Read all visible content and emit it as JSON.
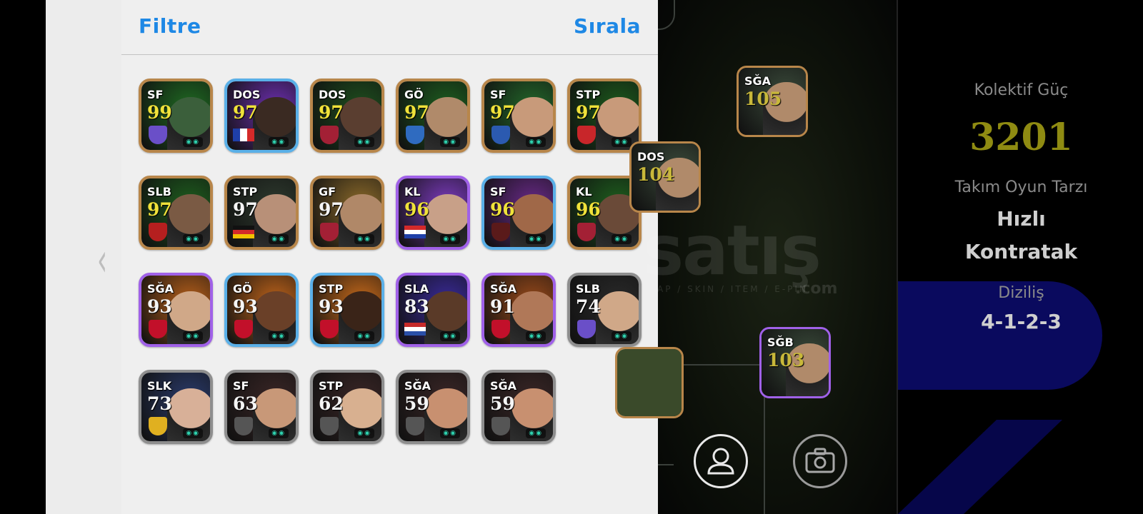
{
  "header": {
    "filter_label": "Filtre",
    "sort_label": "Sırala"
  },
  "cards": [
    {
      "pos": "SF",
      "rating": "99",
      "frame": "gold",
      "bg": "#1f6b22",
      "rating_color": "yellow",
      "badge": "#6a4fc8",
      "face": "#3b5f3b"
    },
    {
      "pos": "DOS",
      "rating": "97",
      "frame": "blue",
      "bg": "#6d2fb0",
      "rating_color": "yellow",
      "badge": "flag-fr",
      "face": "#3a2a22"
    },
    {
      "pos": "DOS",
      "rating": "97",
      "frame": "gold",
      "bg": "#1e4f1e",
      "rating_color": "yellow",
      "badge": "#a32035",
      "face": "#5a3e30"
    },
    {
      "pos": "GÖ",
      "rating": "97",
      "frame": "gold",
      "bg": "#1d5e1f",
      "rating_color": "yellow",
      "badge": "#2f6bc0",
      "face": "#b08a6a"
    },
    {
      "pos": "SF",
      "rating": "97",
      "frame": "gold",
      "bg": "#23672a",
      "rating_color": "yellow",
      "badge": "#2b5ab0",
      "face": "#c89a7a"
    },
    {
      "pos": "STP",
      "rating": "97",
      "frame": "gold",
      "bg": "#1c5a1c",
      "rating_color": "yellow",
      "badge": "#c8262a",
      "face": "#c89a7a"
    },
    {
      "pos": "SLB",
      "rating": "97",
      "frame": "gold",
      "bg": "#1e5e1e",
      "rating_color": "yellow",
      "badge": "#b51f1f",
      "face": "#7a5a44"
    },
    {
      "pos": "STP",
      "rating": "97",
      "frame": "gold",
      "bg": "#2e3a2e",
      "rating_color": "white",
      "badge": "flag-de",
      "face": "#b89078"
    },
    {
      "pos": "GF",
      "rating": "97",
      "frame": "gold",
      "bg": "#8c6a2a",
      "rating_color": "white",
      "badge": "#a32035",
      "face": "#b08868"
    },
    {
      "pos": "KL",
      "rating": "96",
      "frame": "purple",
      "bg": "#7d3bc0",
      "rating_color": "yellow",
      "badge": "flag-hr",
      "face": "#c8a088"
    },
    {
      "pos": "SF",
      "rating": "96",
      "frame": "blue",
      "bg": "#6a2a8a",
      "rating_color": "yellow",
      "badge": "#5a1a1a",
      "face": "#a06848"
    },
    {
      "pos": "KL",
      "rating": "96",
      "frame": "gold",
      "bg": "#1e601e",
      "rating_color": "yellow",
      "badge": "#a32035",
      "face": "#6a4a38"
    },
    {
      "pos": "SĞA",
      "rating": "93",
      "frame": "purple",
      "bg": "#b8601a",
      "rating_color": "white",
      "badge": "#c2102a",
      "face": "#d0a888"
    },
    {
      "pos": "GÖ",
      "rating": "93",
      "frame": "blue",
      "bg": "#c0641a",
      "rating_color": "white",
      "badge": "#c2102a",
      "face": "#6a4028"
    },
    {
      "pos": "STP",
      "rating": "93",
      "frame": "blue",
      "bg": "#c86a1a",
      "rating_color": "white",
      "badge": "#c2102a",
      "face": "#3a2418"
    },
    {
      "pos": "SLA",
      "rating": "83",
      "frame": "purple",
      "bg": "#3a2a9a",
      "rating_color": "white",
      "badge": "flag-nl",
      "face": "#5a3a28"
    },
    {
      "pos": "SĞA",
      "rating": "91",
      "frame": "purple",
      "bg": "#9a4a1a",
      "rating_color": "white",
      "badge": "#c2102a",
      "face": "#b07858"
    },
    {
      "pos": "SLB",
      "rating": "74",
      "frame": "gray",
      "bg": "#2a2a2a",
      "rating_color": "white",
      "badge": "#6a4fc8",
      "face": "#d0a888"
    },
    {
      "pos": "SLK",
      "rating": "73",
      "frame": "gray",
      "bg": "#2a3a6a",
      "rating_color": "white",
      "badge": "#e0b020",
      "face": "#d8b098"
    },
    {
      "pos": "SF",
      "rating": "63",
      "frame": "gray",
      "bg": "#3a2626",
      "rating_color": "white",
      "badge": "#555555",
      "face": "#c89878"
    },
    {
      "pos": "STP",
      "rating": "62",
      "frame": "gray",
      "bg": "#3a2626",
      "rating_color": "white",
      "badge": "#555555",
      "face": "#d8b090"
    },
    {
      "pos": "SĞA",
      "rating": "59",
      "frame": "gray",
      "bg": "#3a2626",
      "rating_color": "white",
      "badge": "#555555",
      "face": "#c89070"
    },
    {
      "pos": "SĞA",
      "rating": "59",
      "frame": "gray",
      "bg": "#3a2626",
      "rating_color": "white",
      "badge": "#555555",
      "face": "#c89070"
    }
  ],
  "pitch_cards": [
    {
      "pos": "SĞA",
      "rating": "105"
    },
    {
      "pos": "DOS",
      "rating": "104"
    },
    {
      "pos": "SĞB",
      "rating": "103"
    }
  ],
  "watermark": {
    "text": "satış",
    "sub": "AP / SKIN / ITEM / E-PIN",
    "com": ".com"
  },
  "info": {
    "power_label": "Kolektif Güç",
    "power_value": "3201",
    "style_label": "Takım Oyun Tarzı",
    "style_value_1": "Hızlı",
    "style_value_2": "Kontratak",
    "formation_label": "Diziliş",
    "formation_value": "4-1-2-3"
  }
}
